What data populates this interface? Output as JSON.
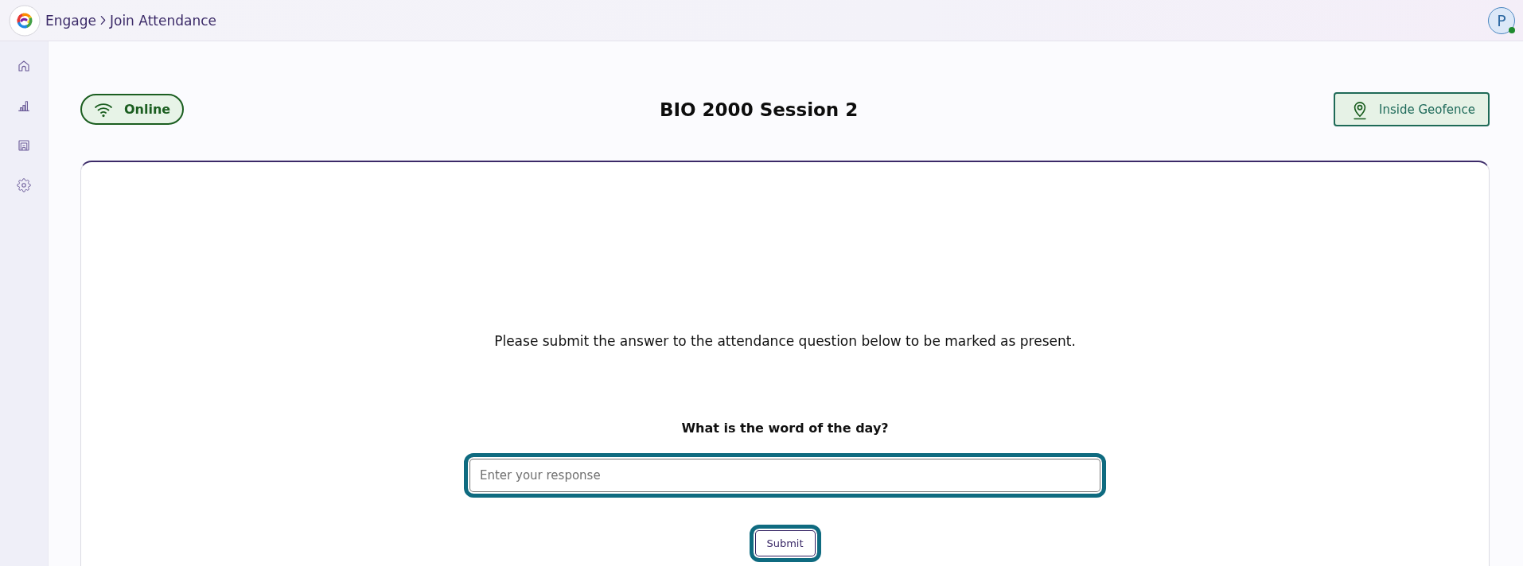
{
  "header": {
    "breadcrumb": [
      {
        "label": "Engage"
      },
      {
        "label": "Join Attendance"
      }
    ],
    "avatar": {
      "initial": "P",
      "online": true
    }
  },
  "sidebar": {
    "items": [
      {
        "kind": "home",
        "selected": false
      },
      {
        "kind": "chart",
        "selected": false
      },
      {
        "kind": "frame",
        "selected": false
      },
      {
        "kind": "settings",
        "selected": false
      }
    ]
  },
  "session": {
    "status": {
      "label": "Online"
    },
    "title": "BIO 2000 Session 2",
    "geofence": {
      "label": "Inside Geofence"
    }
  },
  "card": {
    "instruction": "Please submit the answer to the attendance question below to be marked as present.",
    "question": "What is the word of the day?",
    "response": {
      "placeholder": "Enter your response",
      "highlighted": true
    },
    "submit": {
      "label": "Submit",
      "highlighted": true
    }
  }
}
